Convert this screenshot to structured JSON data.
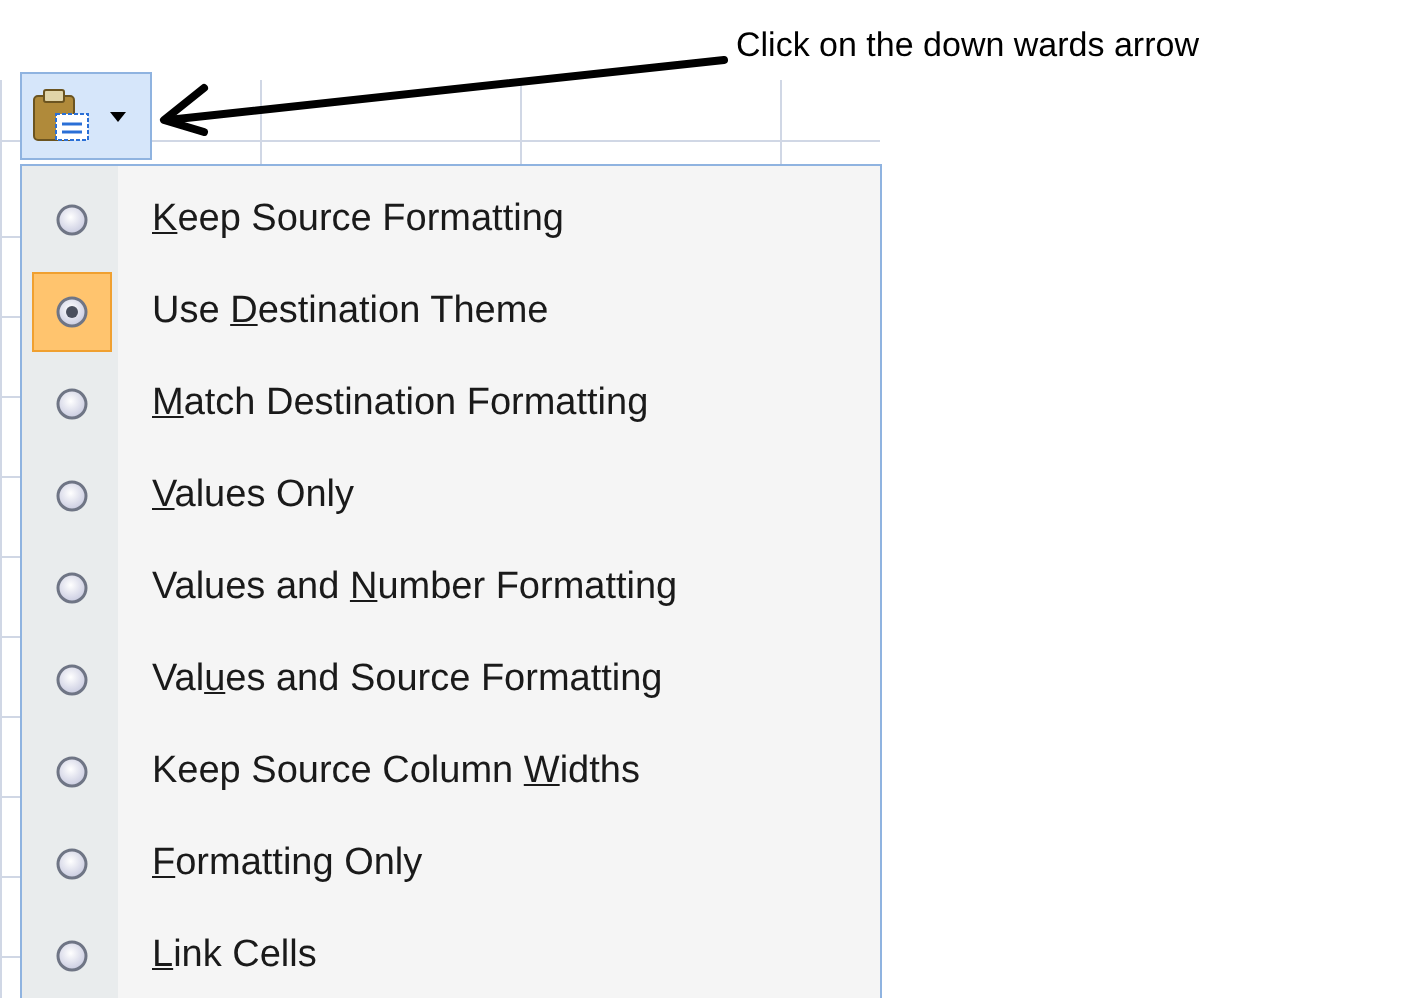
{
  "annotation": {
    "text": "Click on the down wards arrow"
  },
  "paste_button": {
    "expanded": true
  },
  "paste_options": [
    {
      "key": "K",
      "after": "eep Source Formatting",
      "selected": false
    },
    {
      "before": "Use ",
      "key": "D",
      "after": "estination Theme",
      "selected": true
    },
    {
      "key": "M",
      "after": "atch Destination Formatting",
      "selected": false
    },
    {
      "key": "V",
      "after": "alues Only",
      "selected": false
    },
    {
      "before": "Values and ",
      "key": "N",
      "after": "umber Formatting",
      "selected": false
    },
    {
      "before": "Val",
      "key": "u",
      "after": "es and Source Formatting",
      "selected": false
    },
    {
      "before": "Keep Source Column ",
      "key": "W",
      "after": "idths",
      "selected": false
    },
    {
      "key": "F",
      "after": "ormatting Only",
      "selected": false
    },
    {
      "key": "L",
      "after": "ink Cells",
      "selected": false
    }
  ]
}
